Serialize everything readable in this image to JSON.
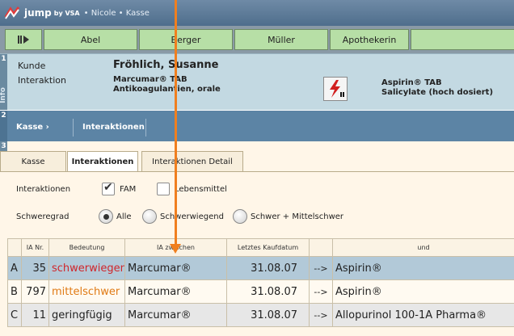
{
  "titlebar": {
    "app": "jump",
    "by": "by VSA",
    "subtitle": "• Nicole • Kasse"
  },
  "user_tabs": [
    {
      "label": "Abel"
    },
    {
      "label": "Berger"
    },
    {
      "label": "Müller"
    },
    {
      "label": "Apothekerin"
    }
  ],
  "panel1": {
    "number": "1",
    "side_label": "Info",
    "customer_label": "Kunde",
    "customer_value": "Fröhlich, Susanne",
    "interaction_label": "Interaktion",
    "drug_a_name": "Marcumar® TAB",
    "drug_a_class": "Antikoagulantien, orale",
    "drug_b_name": "Aspirin® TAB",
    "drug_b_class": "Salicylate (hoch dosiert)"
  },
  "panel2": {
    "number": "2",
    "crumbs": [
      "Kasse ›",
      "Interaktionen"
    ]
  },
  "panel3": {
    "number": "3",
    "tabs": [
      {
        "label": "Kasse"
      },
      {
        "label": "Interaktionen"
      },
      {
        "label": "Interaktionen Detail"
      }
    ],
    "filter_label": "Interaktionen",
    "fam_label": "FAM",
    "fam_checked": true,
    "food_label": "Lebensmittel",
    "food_checked": false,
    "severity_label": "Schweregrad",
    "severity_options": [
      {
        "label": "Alle",
        "selected": true
      },
      {
        "label": "Schwerwiegend",
        "selected": false
      },
      {
        "label": "Schwer + Mittelschwer",
        "selected": false
      }
    ]
  },
  "table": {
    "headers": [
      "",
      "IA Nr.",
      "Bedeutung",
      "IA zwischen",
      "Letztes Kaufdatum",
      "",
      "und"
    ],
    "rows": [
      {
        "letter": "A",
        "nr": "35",
        "meaning": "schwerwiegend",
        "meaning_color": "#d0262b",
        "drug": "Marcumar®",
        "date": "31.08.07",
        "arrow": "-->",
        "other": "Aspirin®"
      },
      {
        "letter": "B",
        "nr": "797",
        "meaning": "mittelschwer",
        "meaning_color": "#e07a14",
        "drug": "Marcumar®",
        "date": "31.08.07",
        "arrow": "-->",
        "other": "Aspirin®"
      },
      {
        "letter": "C",
        "nr": "11",
        "meaning": "geringfügig",
        "meaning_color": "#222222",
        "drug": "Marcumar®",
        "date": "31.08.07",
        "arrow": "-->",
        "other": "Allopurinol 100-1A Pharma®"
      }
    ]
  },
  "colors": {
    "title_bar": "#5a7896",
    "user_tab": "#b7dfa6",
    "info_panel": "#c3d9e2",
    "nav_bar": "#5c84a5",
    "content_bg": "#fff6e8",
    "selected_row": "#b2c9d8",
    "annotation_arrow": "#f07f1f"
  }
}
